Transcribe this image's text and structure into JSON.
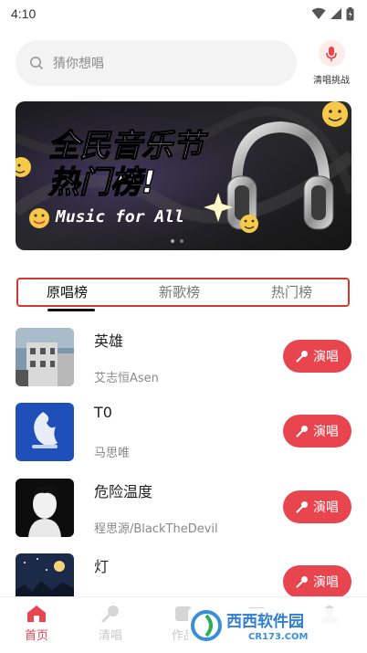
{
  "status": {
    "time": "4:10"
  },
  "search": {
    "placeholder": "猜你想唱"
  },
  "mic": {
    "label": "清唱挑战"
  },
  "banner": {
    "line1": "全民音乐节",
    "line2": "热门榜!",
    "tagline": "Music for All"
  },
  "tabs": [
    {
      "label": "原唱榜",
      "active": true
    },
    {
      "label": "新歌榜",
      "active": false
    },
    {
      "label": "热门榜",
      "active": false
    }
  ],
  "songs": [
    {
      "title": "英雄",
      "artist": "艾志恒Asen",
      "button": "演唱"
    },
    {
      "title": "T0",
      "artist": "马思唯",
      "button": "演唱"
    },
    {
      "title": "危险温度",
      "artist": "程思源/BlackTheDevil",
      "button": "演唱"
    },
    {
      "title": "灯",
      "artist": "",
      "button": "演唱"
    }
  ],
  "nav": [
    {
      "label": "首页",
      "icon": "home-icon",
      "active": true
    },
    {
      "label": "清唱",
      "icon": "mic-icon",
      "active": false
    },
    {
      "label": "作品",
      "icon": "works-icon",
      "active": false
    },
    {
      "label": "",
      "icon": "list-icon",
      "active": false
    },
    {
      "label": "",
      "icon": "profile-icon",
      "active": false
    }
  ],
  "watermark": {
    "brand": "西西软件园",
    "domain": "CR173.COM"
  },
  "colors": {
    "accent": "#e8454f",
    "tab_border": "#d33a2c"
  }
}
